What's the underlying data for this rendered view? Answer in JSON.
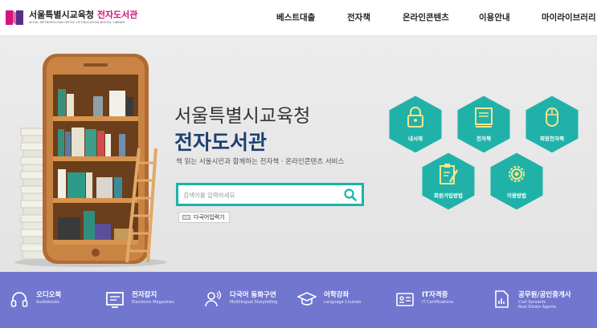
{
  "header": {
    "logo_title_prefix": "서울특별시교육청",
    "logo_title_accent": "전자도서관",
    "logo_subtitle": "SEOUL METROPOLITAN OFFICE OF EDUCATION DIGITAL LIBRARY",
    "nav": [
      "베스트대출",
      "전자책",
      "온라인콘텐츠",
      "이용안내",
      "마이라이브러리"
    ]
  },
  "hero": {
    "title_line1": "서울특별시교육청",
    "title_line2": "전자도서관",
    "subtitle": "책 읽는 서울시민과 함께하는 전자책 · 온라인콘텐츠 서비스",
    "search_placeholder": "검색어를 입력하세요",
    "lang_input_label": "다국어입력기"
  },
  "quick_links": [
    {
      "label": "내서재",
      "icon": "lock-icon"
    },
    {
      "label": "전자책",
      "icon": "book-icon"
    },
    {
      "label": "희망전자책",
      "icon": "mouse-icon"
    },
    {
      "label": "회원가입방법",
      "icon": "clipboard-pen-icon"
    },
    {
      "label": "이용방법",
      "icon": "gear-icon"
    }
  ],
  "categories": [
    {
      "title": "오디오북",
      "sub": "Audiobooks",
      "icon": "headphones-icon"
    },
    {
      "title": "전자잡지",
      "sub": "Electronic Magazines",
      "icon": "magazine-icon"
    },
    {
      "title": "다국어 동화구연",
      "sub": "Multilingual Storytelling",
      "icon": "storyteller-icon"
    },
    {
      "title": "어학강좌",
      "sub": "Language Courses",
      "icon": "graduation-cap-icon"
    },
    {
      "title": "IT자격증",
      "sub": "IT Certifications",
      "icon": "id-card-icon"
    },
    {
      "title": "공무원/공인중개사",
      "sub": "Civil Servants\nReal Estate Agents",
      "icon": "document-chart-icon"
    }
  ],
  "colors": {
    "brand_pink": "#d0177d",
    "teal": "#1bb3a8",
    "navy": "#1d3f73",
    "bottom_bar": "#7176cf"
  }
}
